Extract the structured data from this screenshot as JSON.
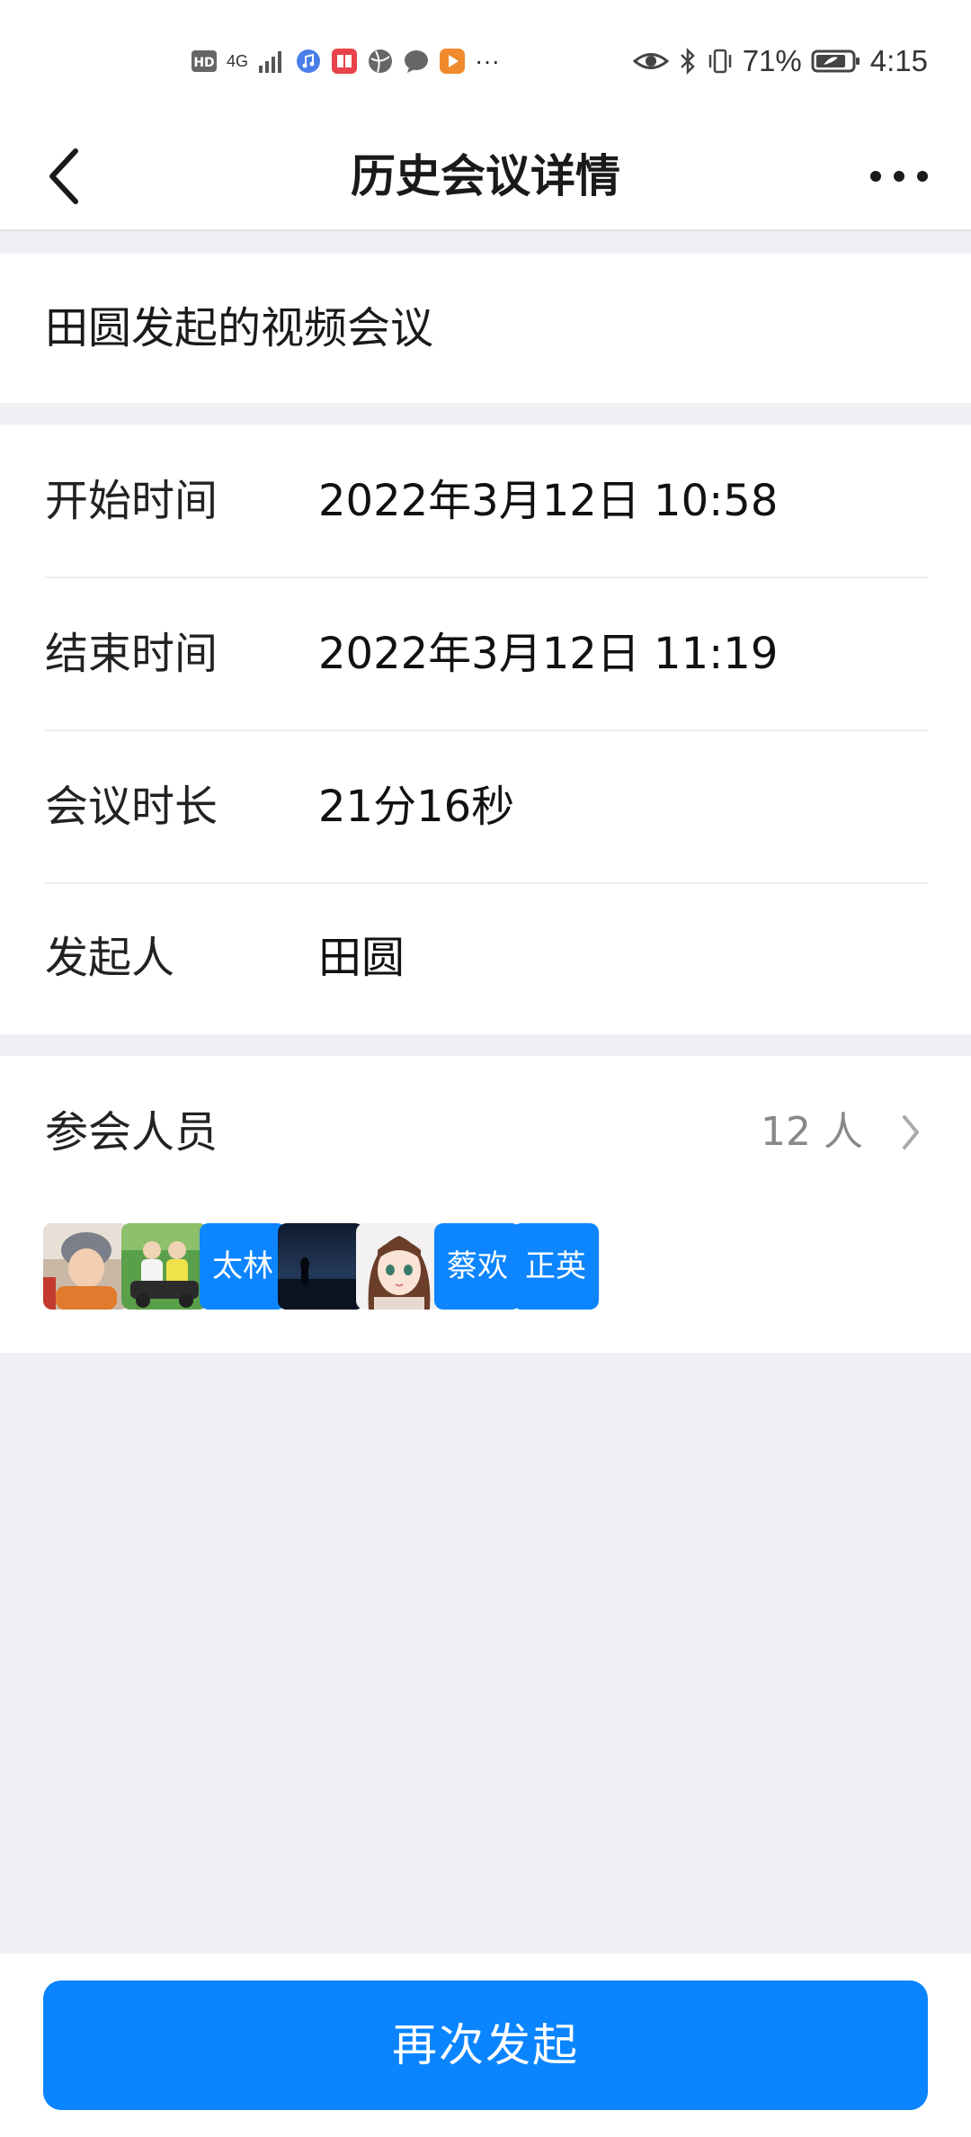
{
  "status_bar": {
    "network": "4G",
    "battery_percent": "71%",
    "time": "4:15",
    "more": "···",
    "icons": [
      "hd-icon",
      "signal-icon",
      "music-icon",
      "book-app-icon",
      "browser-icon",
      "chat-icon",
      "video-app-icon",
      "eye-icon",
      "bluetooth-icon",
      "vibrate-icon",
      "battery-icon"
    ]
  },
  "nav": {
    "title": "历史会议详情"
  },
  "meeting": {
    "title": "田圆发起的视频会议"
  },
  "info": {
    "rows": [
      {
        "label": "开始时间",
        "value": "2022年3月12日 10:58"
      },
      {
        "label": "结束时间",
        "value": "2022年3月12日 11:19"
      },
      {
        "label": "会议时长",
        "value": "21分16秒"
      },
      {
        "label": "发起人",
        "value": "田圆"
      }
    ]
  },
  "participants": {
    "label": "参会人员",
    "count": "12 人",
    "avatars": [
      {
        "type": "photo",
        "name": "avatar-child-photo"
      },
      {
        "type": "photo",
        "name": "avatar-group-photo"
      },
      {
        "type": "text",
        "text": "太林"
      },
      {
        "type": "photo",
        "name": "avatar-night-photo"
      },
      {
        "type": "photo",
        "name": "avatar-anime-photo"
      },
      {
        "type": "text",
        "text": "蔡欢"
      },
      {
        "type": "text",
        "text": "正英"
      }
    ]
  },
  "bottom": {
    "button_label": "再次发起"
  },
  "colors": {
    "accent": "#0a84ff",
    "background": "#f0f0f4",
    "avatar_text_bg": "#0c85ff"
  }
}
